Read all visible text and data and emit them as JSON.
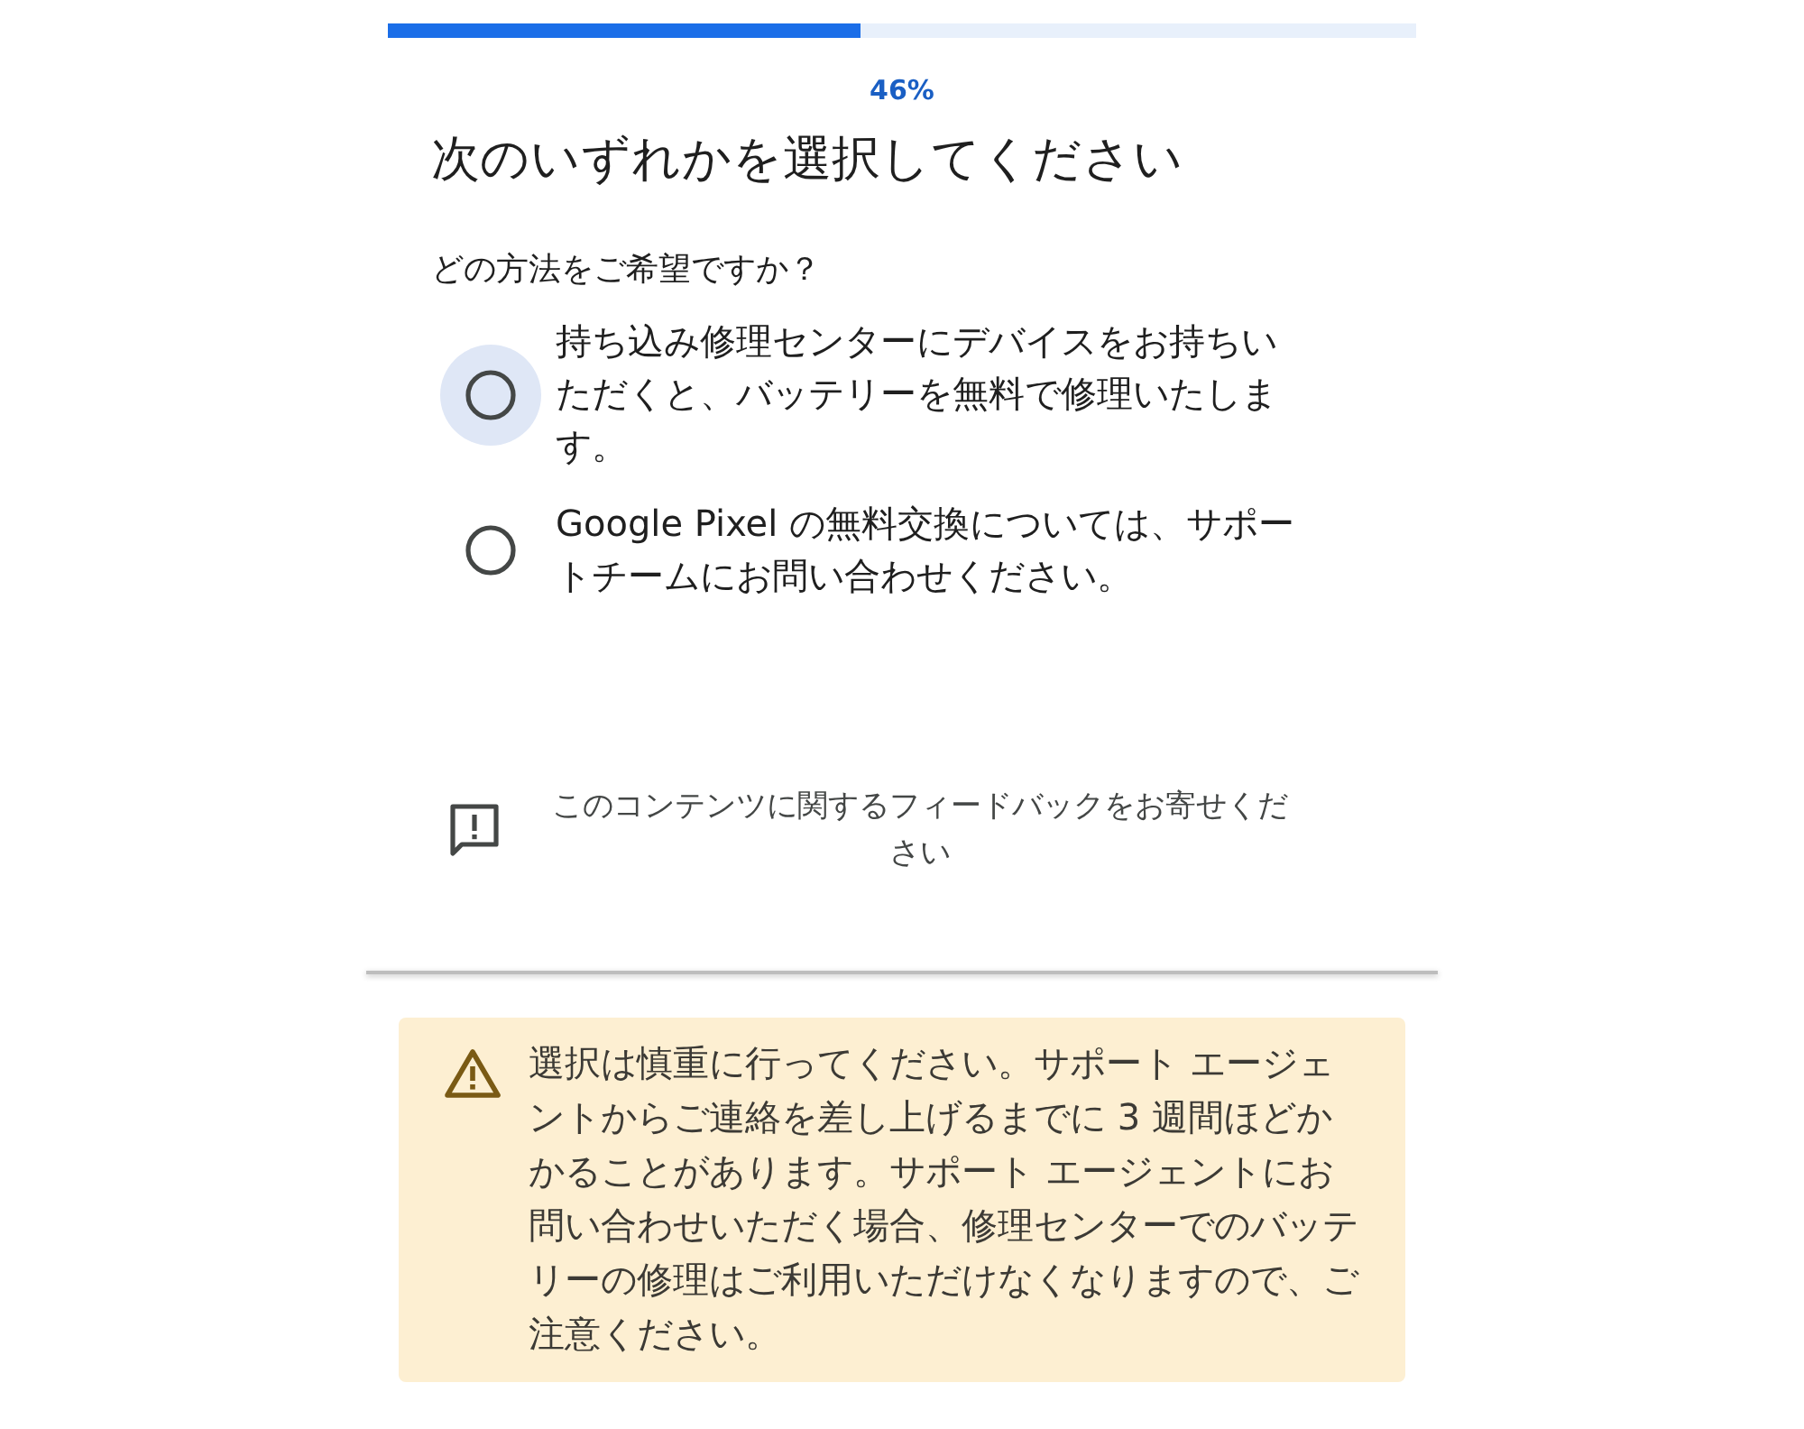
{
  "progress": {
    "level": 0.46,
    "label": "46%"
  },
  "title": "次のいずれかを選択してください",
  "question": "どの方法をご希望ですか？",
  "options": [
    {
      "label": "持ち込み修理センターにデバイスをお持ちいただくと、バッテリーを無料で修理いたします。",
      "selected": false,
      "focused": true
    },
    {
      "label": "Google Pixel の無料交換については、サポートチームにお問い合わせください。",
      "selected": false,
      "focused": false
    }
  ],
  "feedback": {
    "label": "このコンテンツに関するフィードバックをお寄せください"
  },
  "warning": {
    "text": "選択は慎重に行ってください。サポート エージェントからご連絡を差し上げるまでに 3 週間ほどかかることがあります。サポート エージェントにお問い合わせいただく場合、修理センターでのバッテリーの修理はご利用いただけなくなりますので、ご注意ください。"
  }
}
